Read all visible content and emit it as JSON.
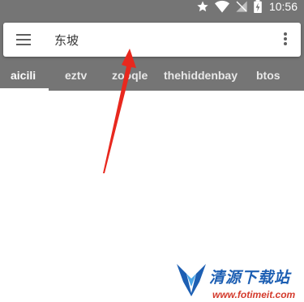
{
  "status_bar": {
    "time": "10:56",
    "icons": [
      "star-icon",
      "wifi-icon",
      "no-sim-icon",
      "battery-charging-icon"
    ]
  },
  "search": {
    "menu_icon": "hamburger-menu-icon",
    "query": "东坡",
    "overflow_icon": "more-vert-icon"
  },
  "tabs": [
    {
      "label": "aicili",
      "active": true
    },
    {
      "label": "eztv",
      "active": false
    },
    {
      "label": "zooqle",
      "active": false
    },
    {
      "label": "thehiddenbay",
      "active": false
    },
    {
      "label": "btos",
      "active": false
    }
  ],
  "colors": {
    "appbar": "#757575",
    "annotation_arrow": "#e8281e",
    "watermark_blue": "#1d5fb3",
    "watermark_red": "#d43a2c"
  },
  "watermark": {
    "title": "清源下载站",
    "url": "www.fotimeit.com"
  }
}
